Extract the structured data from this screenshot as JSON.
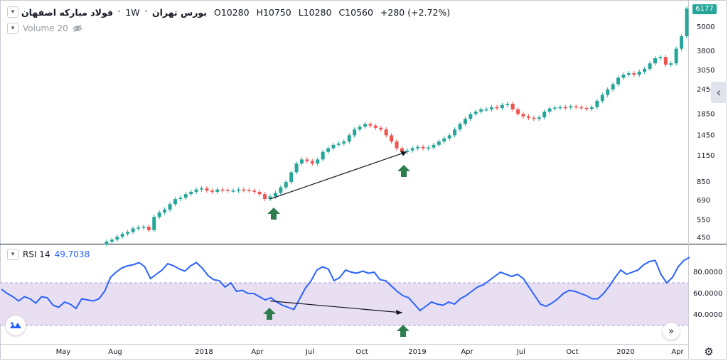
{
  "header": {
    "symbol": "فولاد مبارکه اصفهان",
    "interval": "1W",
    "exchange": "بورس تهران",
    "open_key": "O",
    "open": "10280",
    "high_key": "H",
    "high": "10750",
    "low_key": "L",
    "low": "10280",
    "close_key": "C",
    "close": "10560",
    "change": "+280 (+2.72%)"
  },
  "volume_label": "Volume 20",
  "rsi": {
    "label": "RSI 14",
    "value": "49.7038"
  },
  "last_price_tag": "6177",
  "icons": {
    "collapse": "chevron-down-icon",
    "hidden": "eye-off-icon",
    "scroll": "chevron-left-icon",
    "go_to_realtime": "double-chevron-right-icon",
    "settings": "gear-icon",
    "logo": "tradingview-logo-icon"
  },
  "colors": {
    "up": "#26a69a",
    "down": "#ef5350",
    "rsi_line": "#2962ff",
    "rsi_band": "#e8dff2",
    "arrow_marker": "#2e7d4f"
  },
  "chart_data": [
    {
      "type": "candlestick",
      "scale": "log",
      "y_ticks": [
        "450",
        "550",
        "690",
        "850",
        "1150",
        "1450",
        "1850",
        "2450",
        "3050",
        "3800",
        "5000"
      ],
      "x_ticks": [
        "May",
        "Aug",
        "2018",
        "Apr",
        "Jul",
        "Oct",
        "2019",
        "Apr",
        "Jul",
        "Oct",
        "2020",
        "Apr"
      ],
      "series": [
        {
          "values": [
            430,
            440,
            455,
            470,
            480,
            500,
            505,
            510,
            490,
            570,
            600,
            620,
            660,
            700,
            710,
            740,
            760,
            780,
            790,
            770,
            760,
            780,
            775,
            770,
            770,
            780,
            775,
            770,
            760,
            740,
            700,
            720,
            750,
            800,
            850,
            950,
            1050,
            1100,
            1080,
            1050,
            1100,
            1200,
            1250,
            1300,
            1320,
            1350,
            1450,
            1550,
            1600,
            1650,
            1620,
            1580,
            1550,
            1450,
            1350,
            1250,
            1200,
            1220,
            1250,
            1270,
            1250,
            1260,
            1300,
            1350,
            1400,
            1450,
            1550,
            1650,
            1750,
            1850,
            1900,
            1950,
            1950,
            2000,
            1980,
            2050,
            2080,
            1950,
            1850,
            1800,
            1770,
            1750,
            1780,
            1900,
            1970,
            1990,
            2000,
            1990,
            2020,
            2000,
            1980,
            1960,
            2000,
            2150,
            2300,
            2450,
            2600,
            2800,
            2900,
            2950,
            2900,
            3000,
            3100,
            3300,
            3500,
            3550,
            3250,
            3300,
            3900,
            4500,
            6177
          ]
        }
      ],
      "annotations": [
        {
          "kind": "trendline",
          "from": {
            "x": "Apr 2018",
            "y": 700
          },
          "to": {
            "x": "Dec 2018",
            "y": 1200
          }
        },
        {
          "kind": "marker-arrow-up",
          "x": "Apr 2018"
        },
        {
          "kind": "marker-arrow-up",
          "x": "Dec 2018"
        }
      ]
    },
    {
      "type": "line",
      "title": "RSI 14",
      "y_ticks": [
        "40.0000",
        "60.0000",
        "80.0000"
      ],
      "band": [
        30,
        70
      ],
      "series": [
        {
          "name": "RSI 14",
          "values": [
            64,
            60,
            57,
            53,
            57,
            55,
            51,
            57,
            56,
            49,
            47,
            52,
            50,
            46,
            55,
            54,
            53,
            55,
            62,
            75,
            80,
            84,
            86,
            87,
            89,
            85,
            74,
            78,
            82,
            88,
            86,
            83,
            81,
            86,
            89,
            84,
            77,
            73,
            72,
            66,
            70,
            62,
            63,
            60,
            60,
            57,
            54,
            56,
            52,
            49,
            47,
            45,
            55,
            65,
            72,
            82,
            85,
            83,
            72,
            75,
            82,
            80,
            79,
            81,
            79,
            80,
            73,
            72,
            67,
            62,
            58,
            56,
            50,
            44,
            48,
            52,
            50,
            49,
            52,
            50,
            55,
            58,
            62,
            66,
            68,
            72,
            76,
            80,
            78,
            76,
            78,
            74,
            66,
            58,
            50,
            48,
            51,
            55,
            60,
            63,
            62,
            60,
            58,
            55,
            55,
            60,
            67,
            75,
            82,
            78,
            80,
            82,
            87,
            90,
            91,
            78,
            70,
            75,
            85,
            91,
            94
          ]
        }
      ],
      "annotations": [
        {
          "kind": "trendline",
          "from": {
            "x": "Apr 2018",
            "y": 53
          },
          "to": {
            "x": "Dec 2018",
            "y": 42
          }
        },
        {
          "kind": "marker-arrow-up",
          "x": "Apr 2018"
        },
        {
          "kind": "marker-arrow-up",
          "x": "Dec 2018"
        }
      ]
    }
  ]
}
